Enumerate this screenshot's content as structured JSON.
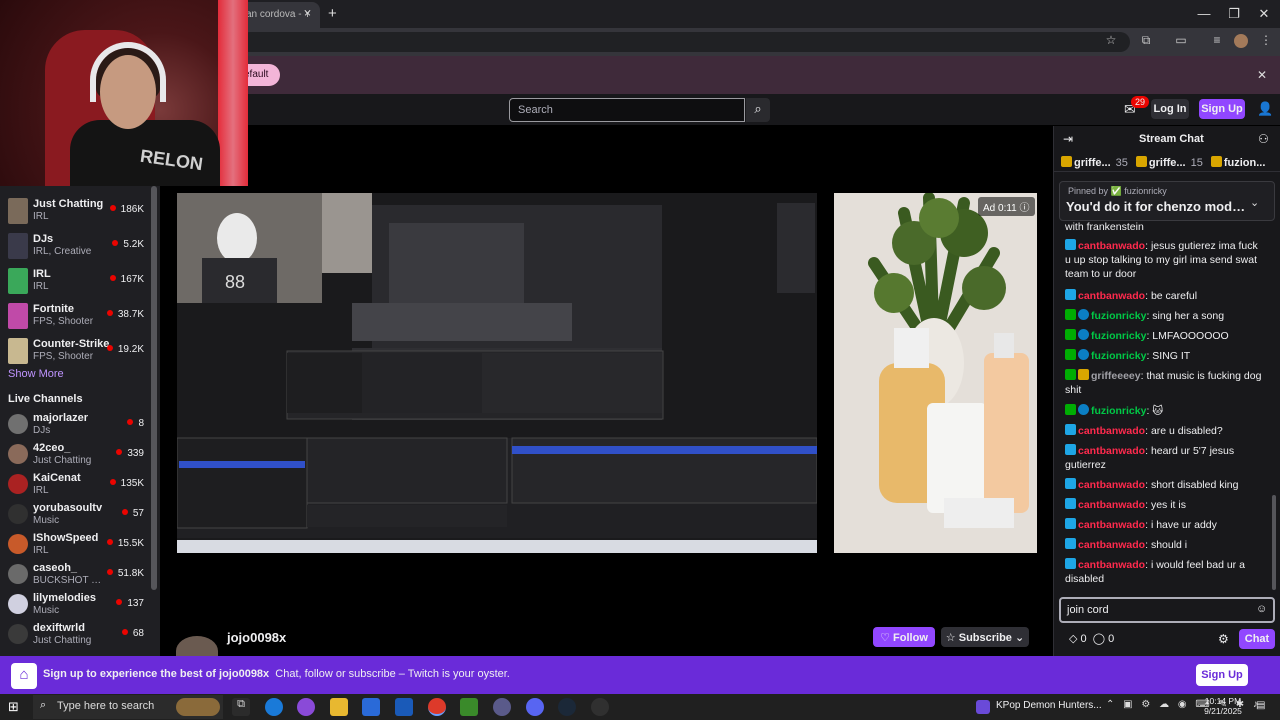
{
  "browser": {
    "tab_title": "an cordova - Y",
    "tab_close": "×",
    "new_tab": "+",
    "infobar_button": "efault",
    "infobar_close": "✕",
    "window_minimize": "—",
    "window_restore": "❐",
    "window_close": "✕"
  },
  "nav": {
    "search_placeholder": "Search",
    "inbox_count": "29",
    "login": "Log In",
    "signup": "Sign Up"
  },
  "webcam": {
    "shirt_text": "RELON"
  },
  "sidebar": {
    "categories": [
      {
        "name": "Just Chatting",
        "sub": "IRL",
        "count": "186K",
        "color": "#7a6a5a"
      },
      {
        "name": "DJs",
        "sub": "IRL, Creative",
        "count": "5.2K",
        "color": "#3a3a4a"
      },
      {
        "name": "IRL",
        "sub": "IRL",
        "count": "167K",
        "color": "#3aa85a"
      },
      {
        "name": "Fortnite",
        "sub": "FPS, Shooter",
        "count": "38.7K",
        "color": "#c04aa8"
      },
      {
        "name": "Counter-Strike",
        "sub": "FPS, Shooter",
        "count": "19.2K",
        "color": "#c8b890"
      }
    ],
    "show_more": "Show More",
    "live_heading": "Live Channels",
    "channels": [
      {
        "name": "majorlazer",
        "sub": "DJs",
        "count": "8",
        "color": "#707070"
      },
      {
        "name": "42ceo_",
        "sub": "Just Chatting",
        "count": "339",
        "color": "#8a6a5a"
      },
      {
        "name": "KaiCenat",
        "sub": "IRL",
        "count": "135K",
        "color": "#aa2222"
      },
      {
        "name": "yorubasoultv",
        "sub": "Music",
        "count": "57",
        "color": "#303030"
      },
      {
        "name": "IShowSpeed",
        "sub": "IRL",
        "count": "15.5K",
        "color": "#c85a2a"
      },
      {
        "name": "caseoh_",
        "sub": "BUCKSHOT ROULETTE",
        "count": "51.8K",
        "color": "#6a6a6a"
      },
      {
        "name": "lilymelodies",
        "sub": "Music",
        "count": "137",
        "color": "#d0d0e0"
      },
      {
        "name": "dexiftwrld",
        "sub": "Just Chatting",
        "count": "68",
        "color": "#3a3a3a"
      }
    ]
  },
  "stream": {
    "ad_label": "Ad 0:11",
    "channel_name": "jojo0098x",
    "follow": "Follow",
    "subscribe": "Subscribe"
  },
  "chat": {
    "title": "Stream Chat",
    "leaderboard": [
      {
        "name": "griffe...",
        "count": "35"
      },
      {
        "name": "griffe...",
        "count": "15"
      },
      {
        "name": "fuzion...",
        "count": ""
      }
    ],
    "pinned_by": "Pinned by ✅ fuzionricky",
    "pinned_msg": "You'd do it for chenzo mod ...",
    "partial_line": "with frankenstein",
    "messages": [
      {
        "user": "cantbanwado",
        "cls": "u-red",
        "badges": [
          "prime"
        ],
        "text": "jesus gutierez ima fuck u up stop talking to my girl ima send swat team to ur door"
      },
      {
        "user": "cantbanwado",
        "cls": "u-red",
        "badges": [
          "prime"
        ],
        "text": "be careful"
      },
      {
        "user": "fuzionricky",
        "cls": "u-green",
        "badges": [
          "mod",
          "vip"
        ],
        "text": "sing her a song"
      },
      {
        "user": "fuzionricky",
        "cls": "u-green",
        "badges": [
          "mod",
          "vip"
        ],
        "text": "LMFAOOOOOO"
      },
      {
        "user": "fuzionricky",
        "cls": "u-green",
        "badges": [
          "mod",
          "vip"
        ],
        "text": "SING IT"
      },
      {
        "user": "griffeeeey",
        "cls": "u-grey",
        "badges": [
          "mod",
          "crown"
        ],
        "text": "that music is fucking dog shit"
      },
      {
        "user": "fuzionricky",
        "cls": "u-green",
        "badges": [
          "mod",
          "vip"
        ],
        "text": "🐱"
      },
      {
        "user": "cantbanwado",
        "cls": "u-red",
        "badges": [
          "prime"
        ],
        "text": "are u disabled?"
      },
      {
        "user": "cantbanwado",
        "cls": "u-red",
        "badges": [
          "prime"
        ],
        "text": "heard ur 5'7 jesus gutierrez"
      },
      {
        "user": "cantbanwado",
        "cls": "u-red",
        "badges": [
          "prime"
        ],
        "text": "short disabled king"
      },
      {
        "user": "cantbanwado",
        "cls": "u-red",
        "badges": [
          "prime"
        ],
        "text": "yes it is"
      },
      {
        "user": "cantbanwado",
        "cls": "u-red",
        "badges": [
          "prime"
        ],
        "text": "i have ur addy"
      },
      {
        "user": "cantbanwado",
        "cls": "u-red",
        "badges": [
          "prime"
        ],
        "text": "should i"
      },
      {
        "user": "cantbanwado",
        "cls": "u-red",
        "badges": [
          "prime"
        ],
        "text": "i would feel bad ur a disabled"
      }
    ],
    "input_value": "join cord",
    "points_a": "0",
    "points_b": "0",
    "send": "Chat"
  },
  "banner": {
    "text_lead": "Sign up to experience the best of jojo0098x",
    "text_rest": "Chat, follow or subscribe – Twitch is your oyster.",
    "button": "Sign Up"
  },
  "taskbar": {
    "search_placeholder": "Type here to search",
    "media_title": "KPop Demon Hunters...",
    "time": "10:14 PM",
    "date": "9/21/2025"
  }
}
